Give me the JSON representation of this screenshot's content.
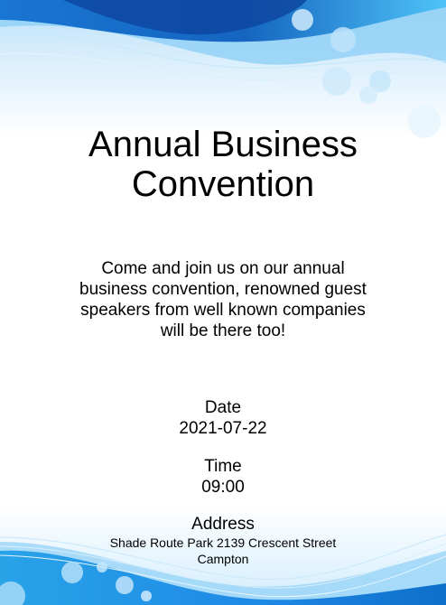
{
  "invitation": {
    "title": "Annual Business Convention",
    "description": "Come and join us on our annual business convention, renowned guest speakers from well known companies will be there too!",
    "date_label": "Date",
    "date_value": "2021-07-22",
    "time_label": "Time",
    "time_value": "09:00",
    "address_label": "Address",
    "address_value": "Shade Route Park 2139 Crescent Street Campton"
  },
  "colors": {
    "wave_primary": "#1e88e5",
    "wave_dark": "#0d47a1",
    "wave_light": "#bbdefb",
    "text": "#000000",
    "background": "#ffffff"
  }
}
